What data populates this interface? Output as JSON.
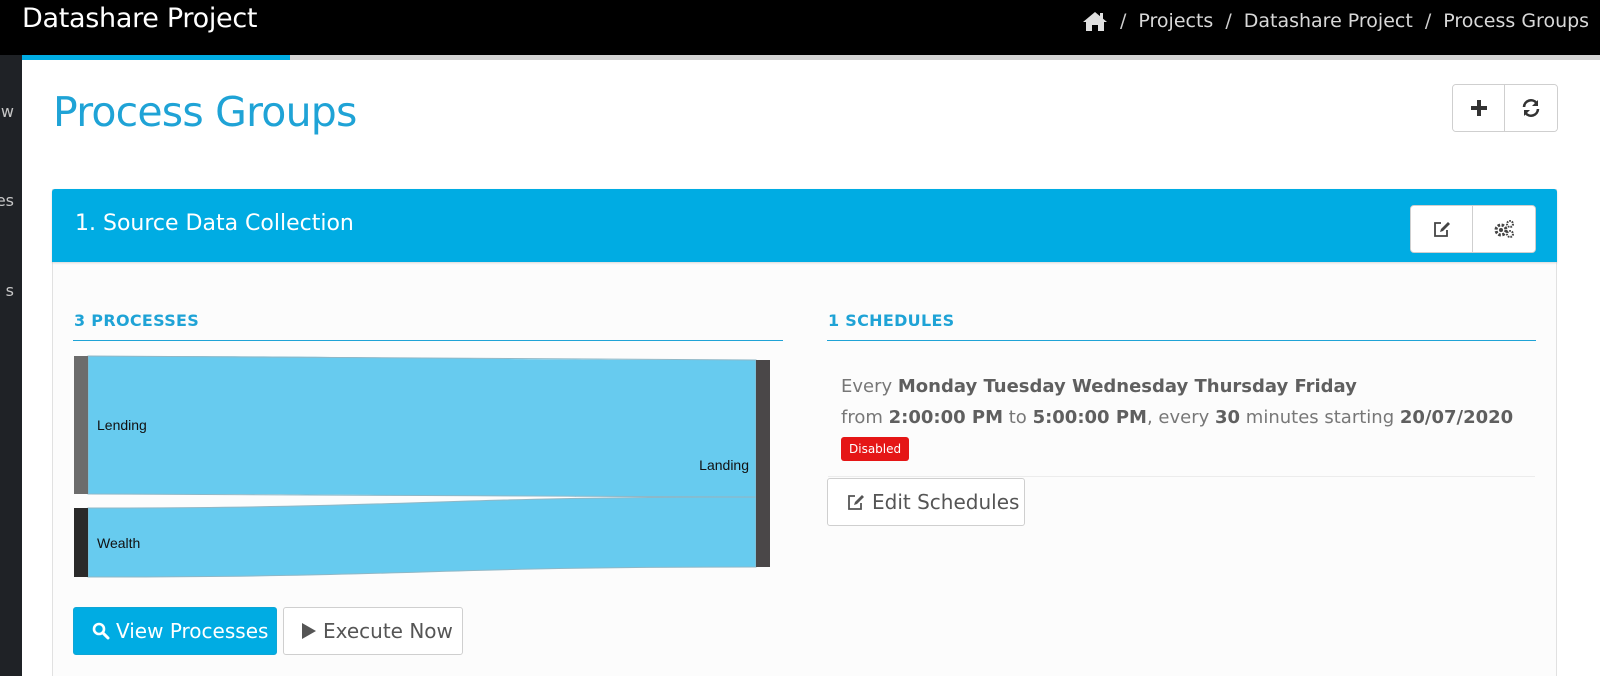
{
  "colors": {
    "accent": "#00ACE3",
    "title": "#1FA3D6",
    "flow": "#67CBEF",
    "badge_red": "#E51616",
    "node_dark": "#4a4748"
  },
  "header": {
    "app_title": "Datashare Project",
    "breadcrumb": {
      "home_icon": "home-icon",
      "separator": "/",
      "items": [
        "Projects",
        "Datashare Project",
        "Process Groups"
      ]
    },
    "progress_percent": 17
  },
  "sidebar": {
    "visible_fragments": [
      "w",
      "es",
      "s"
    ]
  },
  "page": {
    "title": "Process Groups",
    "actions": [
      {
        "icon": "plus-icon",
        "label": ""
      },
      {
        "icon": "refresh-icon",
        "label": ""
      }
    ]
  },
  "group": {
    "title": "1. Source Data Collection",
    "actions": [
      {
        "icon": "edit-icon"
      },
      {
        "icon": "gears-icon"
      }
    ],
    "processes": {
      "heading": "3 PROCESSES",
      "sankey": {
        "sources": [
          {
            "name": "Lending",
            "value": 2.0
          },
          {
            "name": "Wealth",
            "value": 1.0
          }
        ],
        "target": "Landing"
      },
      "view_button": "View Processes",
      "execute_button": "Execute Now"
    },
    "schedules": {
      "heading": "1 SCHEDULES",
      "line1_prefix": "Every",
      "days": "Monday Tuesday Wednesday Thursday Friday",
      "from_word": "from",
      "start_time": "2:00:00 PM",
      "to_word": "to",
      "end_time": "5:00:00 PM",
      "every_word": ", every",
      "interval": "30",
      "minutes_starting": "minutes starting",
      "start_date": "20/07/2020",
      "status": "Disabled",
      "edit_button": "Edit Schedules"
    }
  }
}
